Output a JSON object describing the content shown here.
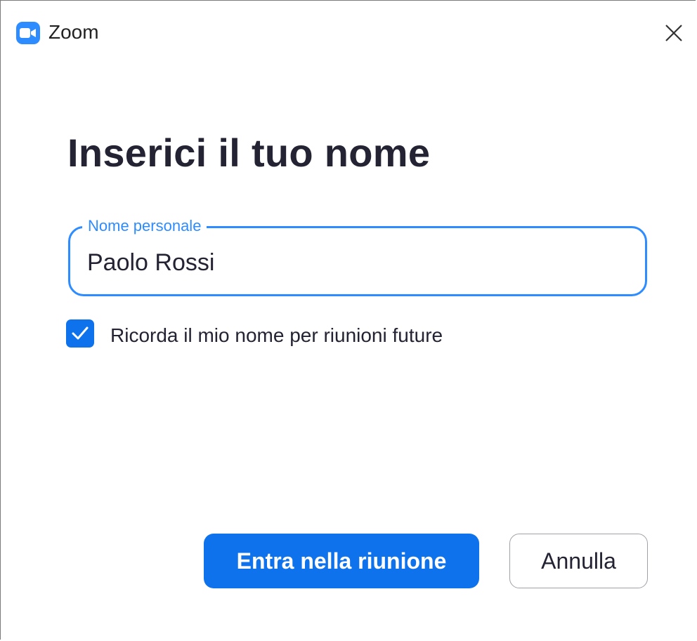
{
  "window": {
    "title": "Zoom",
    "app_icon": "zoom-camera-icon",
    "close_icon": "close-icon"
  },
  "dialog": {
    "heading": "Inserici il tuo nome",
    "name_field": {
      "label": "Nome personale",
      "value": "Paolo Rossi"
    },
    "remember_checkbox": {
      "checked": true,
      "label": "Ricorda il mio nome per riunioni future"
    },
    "buttons": {
      "join_label": "Entra nella riunione",
      "cancel_label": "Annulla"
    }
  },
  "colors": {
    "accent": "#0e72ed",
    "focus": "#2d8cff",
    "text": "#232333"
  }
}
